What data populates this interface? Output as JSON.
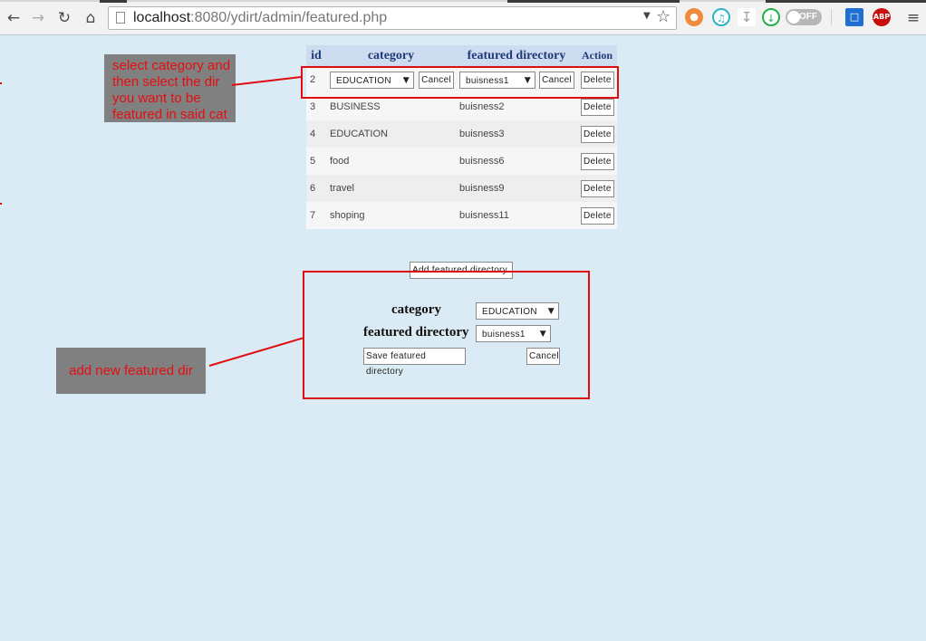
{
  "browser": {
    "url_host": "localhost",
    "url_path": ":8080/ydirt/admin/featured.php",
    "toggle_label": "OFF",
    "abp_label": "ABP"
  },
  "table": {
    "headers": {
      "id": "id",
      "category": "category",
      "featured_directory": "featured directory",
      "action": "Action"
    },
    "edit_row": {
      "id": "2",
      "category_selected": "EDUCATION",
      "directory_selected": "buisness1",
      "cancel_label": "Cancel",
      "delete_label": "Delete"
    },
    "rows": [
      {
        "id": "3",
        "category": "BUSINESS",
        "directory": "buisness2",
        "delete": "Delete"
      },
      {
        "id": "4",
        "category": "EDUCATION",
        "directory": "buisness3",
        "delete": "Delete"
      },
      {
        "id": "5",
        "category": "food",
        "directory": "buisness6",
        "delete": "Delete"
      },
      {
        "id": "6",
        "category": "travel",
        "directory": "buisness9",
        "delete": "Delete"
      },
      {
        "id": "7",
        "category": "shoping",
        "directory": "buisness11",
        "delete": "Delete"
      }
    ]
  },
  "add_form": {
    "add_button": "Add featured directory",
    "category_label": "category",
    "category_selected": "EDUCATION",
    "directory_label": "featured directory",
    "directory_selected": "buisness1",
    "save_button": "Save featured directory",
    "cancel_button": "Cancel"
  },
  "annotations": {
    "edit_note": "select category and then select the dir you want to be featured in said cat",
    "add_note": "add new featured dir"
  },
  "colors": {
    "annotation": "#e00d10",
    "note_bg": "#808080",
    "page_bg": "#dbebf5"
  }
}
